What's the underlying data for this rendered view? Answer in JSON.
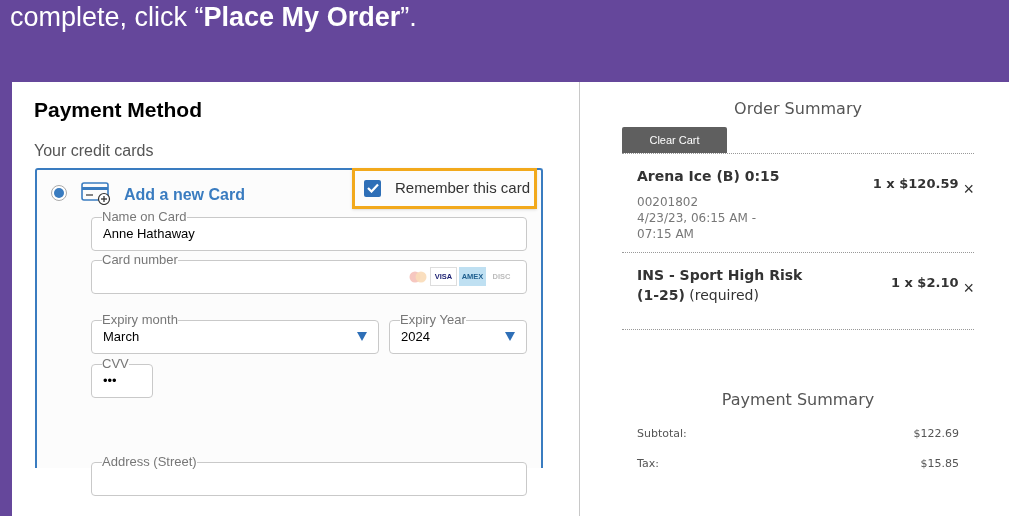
{
  "banner": {
    "text": "complete, click “**Place My Order**”."
  },
  "payment_method": {
    "title": "Payment Method",
    "subtitle": "Your credit cards",
    "new_card": {
      "selected": true,
      "label": "Add a new Card",
      "remember": {
        "label": "Remember this card",
        "checked": true
      },
      "fields": [
        {
          "kind": "text",
          "label": "Name on Card",
          "value": "Anne Hathaway"
        },
        {
          "kind": "card",
          "label": "Card number",
          "brands": [
            "VISA",
            "AMEX",
            "DISC"
          ]
        },
        {
          "kind": "select",
          "label": "Expiry month",
          "value": "March"
        },
        {
          "kind": "select",
          "label": "Expiry Year",
          "value": "2024"
        },
        {
          "kind": "text",
          "label": "CVV",
          "value": "•••"
        },
        {
          "kind": "text",
          "label": "Address (Street)"
        }
      ]
    }
  },
  "order_summary": {
    "title": "Order Summary",
    "clear_button": "Clear Cart",
    "items": [
      {
        "name": "Arena Ice (B) 0:15",
        "details": [
          "00201802",
          "4/23/23, 06:15 AM -",
          "07:15 AM"
        ],
        "price": "1 x $120.59",
        "remove": "×"
      },
      {
        "name": "INS - Sport High Risk",
        "name_suffix": "**(1-25)** (required)",
        "price": "1 x $2.10",
        "remove": "×"
      }
    ]
  },
  "payment_summary": {
    "title": "Payment Summary",
    "rows": [
      {
        "label": "Subtotal:",
        "value": "$122.69"
      },
      {
        "label": "Tax:",
        "value": "$15.85"
      }
    ]
  }
}
